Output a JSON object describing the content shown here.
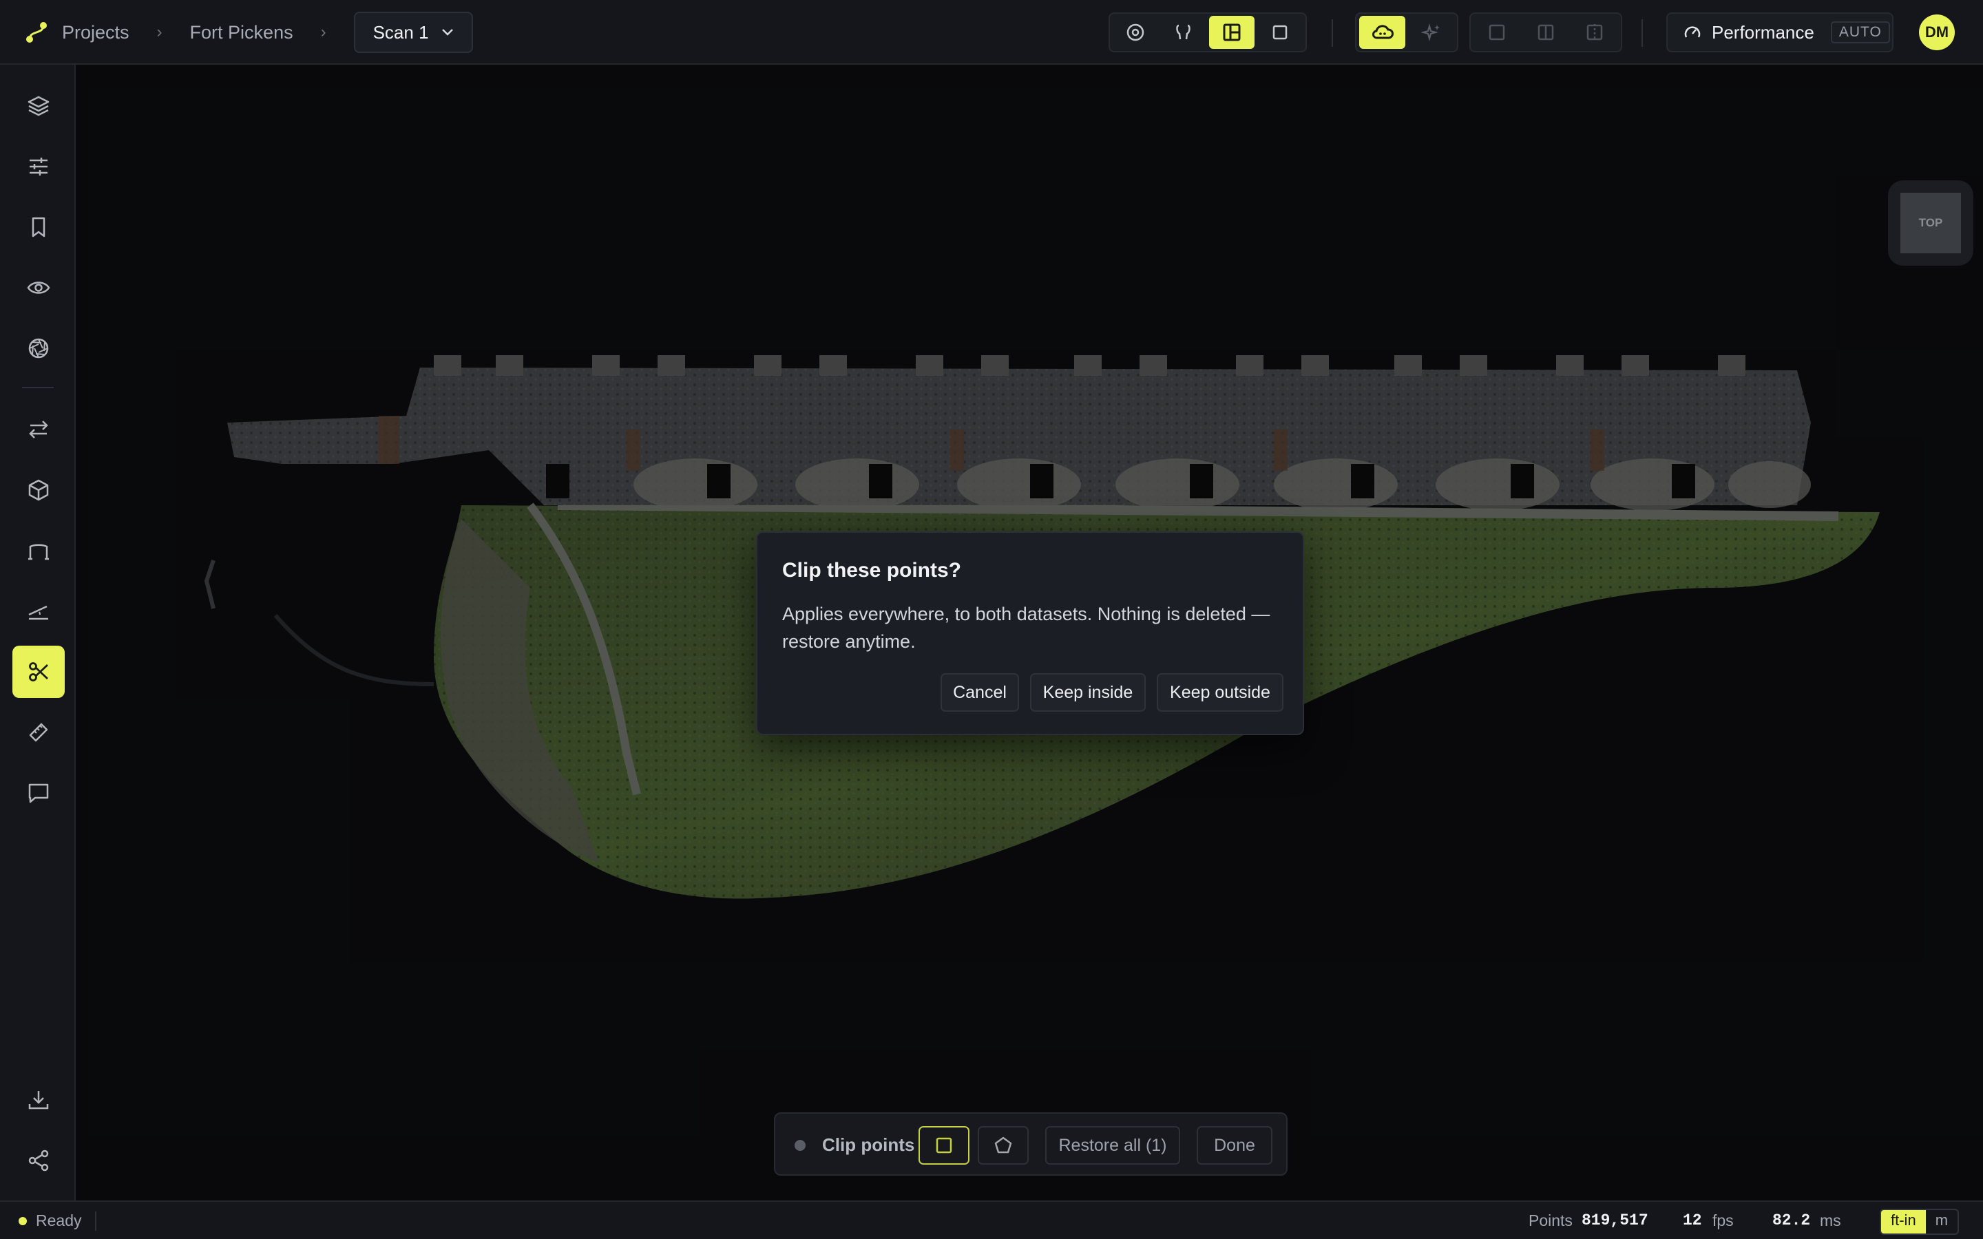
{
  "breadcrumb": {
    "projects": "Projects",
    "site": "Fort Pickens",
    "scan": "Scan 1"
  },
  "toolbar_icons": [
    "orbit-icon",
    "walk-icon",
    "layout-icon",
    "square-icon",
    "cloud-icon",
    "sparkle-icon",
    "single-view-icon",
    "split-view-icon",
    "compare-view-icon"
  ],
  "performance": {
    "label": "Performance",
    "mode": "AUTO"
  },
  "user": {
    "initials": "DM"
  },
  "sidebar_icons": [
    "layers-icon",
    "sliders-icon",
    "bookmark-icon",
    "eye-icon",
    "aperture-icon",
    "swap-icon",
    "cube-icon",
    "section-icon",
    "slope-icon",
    "scissors-icon",
    "ruler-icon",
    "comment-icon",
    "download-icon",
    "share-icon"
  ],
  "nav_cube": {
    "face": "TOP"
  },
  "dialog": {
    "title": "Clip these points?",
    "body": "Applies everywhere, to both datasets. Nothing is deleted — restore anytime.",
    "cancel": "Cancel",
    "keep_inside": "Keep inside",
    "keep_outside": "Keep outside"
  },
  "clip_toolbar": {
    "label": "Clip points",
    "restore": "Restore all (1)",
    "done": "Done"
  },
  "status": {
    "state": "Ready",
    "points_label": "Points",
    "points_value": "819,517",
    "fps_value": "12",
    "fps_label": "fps",
    "ms_value": "82.2",
    "ms_label": "ms",
    "unit_imperial": "ft-in",
    "unit_metric": "m"
  },
  "colors": {
    "accent": "#e8f35a",
    "panel": "#14161b",
    "dialog": "#1b1e24"
  }
}
